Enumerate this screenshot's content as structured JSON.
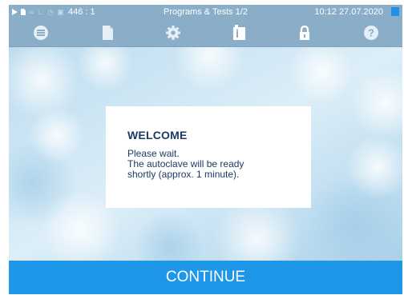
{
  "statusbar": {
    "counter": "446 : 1",
    "title": "Programs & Tests 1/2",
    "time": "10:12",
    "date": "27.07.2020",
    "datetime": "10:12  27.07.2020",
    "icons": [
      "play-icon",
      "document-icon",
      "steam-icon",
      "chart-icon",
      "clock-icon",
      "lock-icon"
    ]
  },
  "navbar": {
    "icons": [
      "menu-icon",
      "document-icon",
      "settings-icon",
      "device-info-icon",
      "lock-icon",
      "help-icon"
    ],
    "active": "device-info-icon"
  },
  "dialog": {
    "title": "WELCOME",
    "message": "Please wait.\nThe autoclave will be ready\nshortly (approx. 1 minute)."
  },
  "continue_button": {
    "label": "CONTINUE"
  },
  "colors": {
    "header": "#8aaec8",
    "accent": "#1e97e8",
    "dialog_text": "#1c3a63",
    "background": "#cfe6f4"
  }
}
